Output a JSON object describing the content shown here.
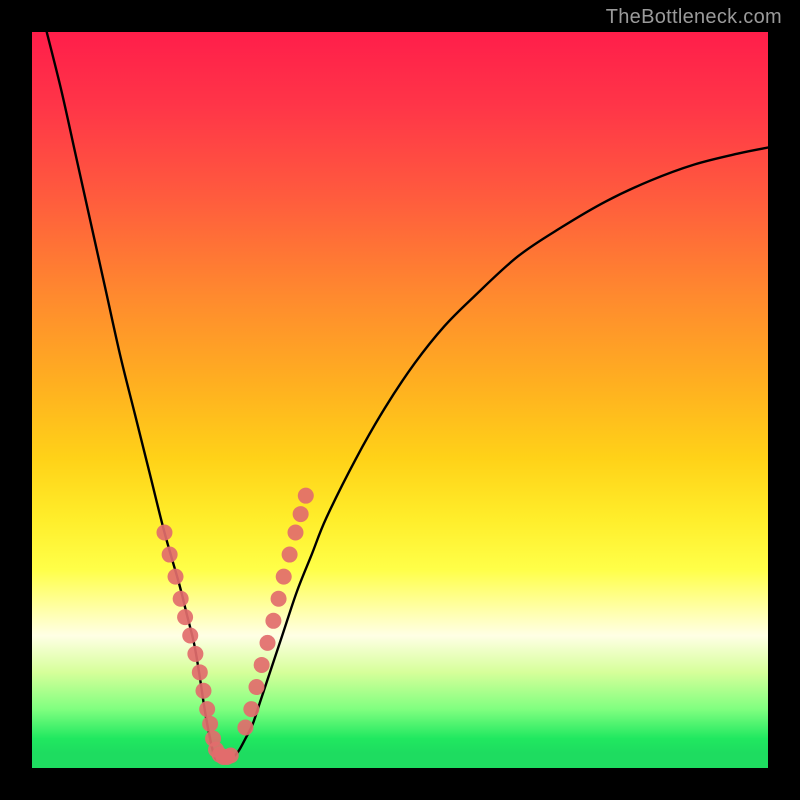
{
  "attribution": "TheBottleneck.com",
  "chart_data": {
    "type": "line",
    "title": "",
    "xlabel": "",
    "ylabel": "",
    "xlim": [
      0,
      100
    ],
    "ylim": [
      0,
      100
    ],
    "series": [
      {
        "name": "left-branch-curve",
        "x": [
          2,
          4,
          6,
          8,
          10,
          12,
          14,
          16,
          18,
          20,
          21,
          22,
          22.7,
          23.3,
          23.8,
          24.2,
          24.6,
          25,
          25.5
        ],
        "values": [
          100,
          92,
          83,
          74,
          65,
          56,
          48,
          40,
          32,
          25,
          21,
          17,
          13,
          9,
          6,
          4,
          2.2,
          1.2,
          1.0
        ]
      },
      {
        "name": "right-branch-curve",
        "x": [
          27,
          28,
          29,
          30,
          31,
          32,
          34,
          36,
          38,
          40,
          44,
          48,
          52,
          56,
          60,
          66,
          72,
          78,
          84,
          90,
          96,
          100
        ],
        "values": [
          1.2,
          2.2,
          4,
          6,
          9,
          12,
          18,
          24,
          29,
          34,
          42,
          49,
          55,
          60,
          64,
          69.5,
          73.5,
          77,
          79.8,
          82,
          83.5,
          84.3
        ]
      },
      {
        "name": "valley-flat",
        "x": [
          25.5,
          26,
          26.5,
          27
        ],
        "values": [
          1.0,
          1.0,
          1.0,
          1.0
        ]
      },
      {
        "name": "scatter-left-markers",
        "type": "scatter",
        "color": "#e26d6d",
        "x": [
          18,
          18.7,
          19.5,
          20.2,
          20.8,
          21.5,
          22.2,
          22.8,
          23.3,
          23.8,
          24.2,
          24.6,
          25,
          25.5,
          26,
          26.5,
          27
        ],
        "values": [
          32,
          29,
          26,
          23,
          20.5,
          18,
          15.5,
          13,
          10.5,
          8,
          6,
          4,
          2.5,
          1.8,
          1.5,
          1.5,
          1.7
        ]
      },
      {
        "name": "scatter-right-markers",
        "type": "scatter",
        "color": "#e26d6d",
        "x": [
          29,
          29.8,
          30.5,
          31.2,
          32,
          32.8,
          33.5,
          34.2,
          35,
          35.8,
          36.5,
          37.2
        ],
        "values": [
          5.5,
          8,
          11,
          14,
          17,
          20,
          23,
          26,
          29,
          32,
          34.5,
          37
        ]
      }
    ]
  }
}
